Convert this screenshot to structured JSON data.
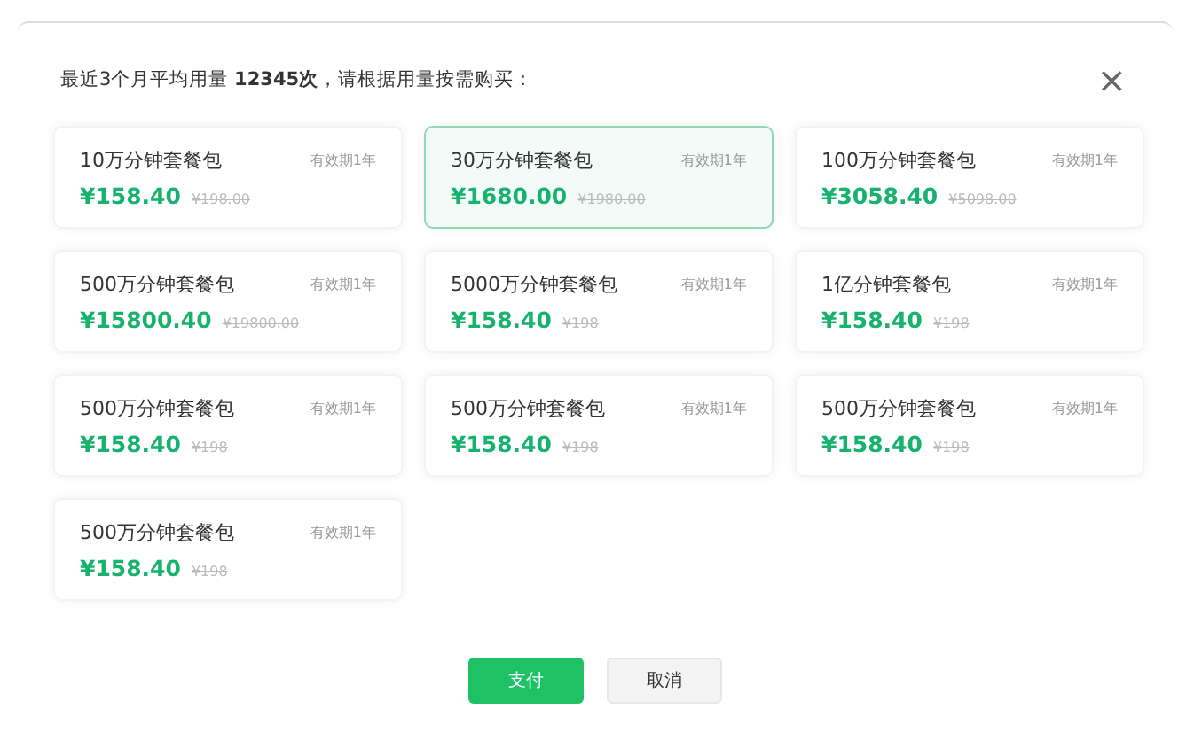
{
  "dialog": {
    "title": "最近3个月平均用量 **12345次**，请根据用量按需购买：",
    "close": "×"
  },
  "packages": [
    {
      "name": "10万分钟套餐包",
      "validity": "有效期1年",
      "price": "¥158.40",
      "original_price": "¥198.00",
      "selected": false
    },
    {
      "name": "30万分钟套餐包",
      "validity": "有效期1年",
      "price": "¥1680.00",
      "original_price": "¥1980.00",
      "selected": true
    },
    {
      "name": "100万分钟套餐包",
      "validity": "有效期1年",
      "price": "¥3058.40",
      "original_price": "¥5098.00",
      "selected": false
    },
    {
      "name": "500万分钟套餐包",
      "validity": "有效期1年",
      "price": "¥15800.40",
      "original_price": "¥19800.00",
      "selected": false
    },
    {
      "name": "5000万分钟套餐包",
      "validity": "有效期1年",
      "price": "¥158.40",
      "original_price": "¥198",
      "selected": false
    },
    {
      "name": "1亿分钟套餐包",
      "validity": "有效期1年",
      "price": "¥158.40",
      "original_price": "¥198",
      "selected": false
    },
    {
      "name": "500万分钟套餐包",
      "validity": "有效期1年",
      "price": "¥158.40",
      "original_price": "¥198",
      "selected": false
    },
    {
      "name": "500万分钟套餐包",
      "validity": "有效期1年",
      "price": "¥158.40",
      "original_price": "¥198",
      "selected": false
    },
    {
      "name": "500万分钟套餐包",
      "validity": "有效期1年",
      "price": "¥158.40",
      "original_price": "¥198",
      "selected": false
    },
    {
      "name": "500万分钟套餐包",
      "validity": "有效期1年",
      "price": "¥158.40",
      "original_price": "¥198",
      "selected": false
    }
  ],
  "buttons": [
    {
      "kind": "primary",
      "label": "支付"
    },
    {
      "kind": "secondary",
      "label": "取消"
    }
  ]
}
